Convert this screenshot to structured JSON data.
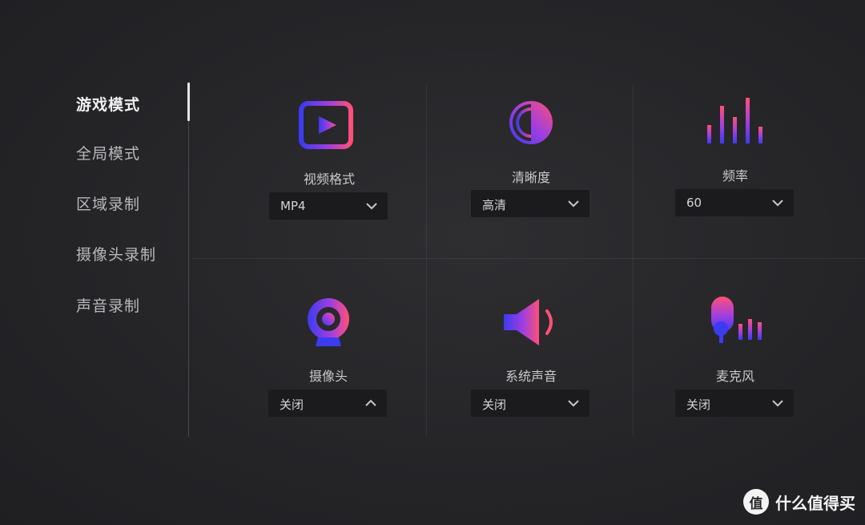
{
  "sidebar": {
    "items": [
      {
        "label": "游戏模式",
        "active": true
      },
      {
        "label": "全局模式",
        "active": false
      },
      {
        "label": "区域录制",
        "active": false
      },
      {
        "label": "摄像头录制",
        "active": false
      },
      {
        "label": "声音录制",
        "active": false
      }
    ]
  },
  "settings": {
    "video_format": {
      "label": "视频格式",
      "value": "MP4",
      "icon": "video-play-icon"
    },
    "clarity": {
      "label": "清晰度",
      "value": "高清",
      "icon": "contrast-circle-icon"
    },
    "frequency": {
      "label": "频率",
      "value": "60",
      "icon": "equalizer-bars-icon"
    },
    "camera": {
      "label": "摄像头",
      "value": "关闭",
      "icon": "webcam-icon",
      "expanded": true
    },
    "system_audio": {
      "label": "系统声音",
      "value": "关闭",
      "icon": "speaker-icon"
    },
    "microphone": {
      "label": "麦克风",
      "value": "关闭",
      "icon": "microphone-icon"
    }
  },
  "watermark": {
    "text": "什么值得买",
    "badge": "值"
  },
  "colors": {
    "accent_blue": "#3d3df2",
    "accent_purple": "#9b3fe0",
    "accent_pink": "#ff4f7b",
    "panel": "#1b1b1e"
  }
}
